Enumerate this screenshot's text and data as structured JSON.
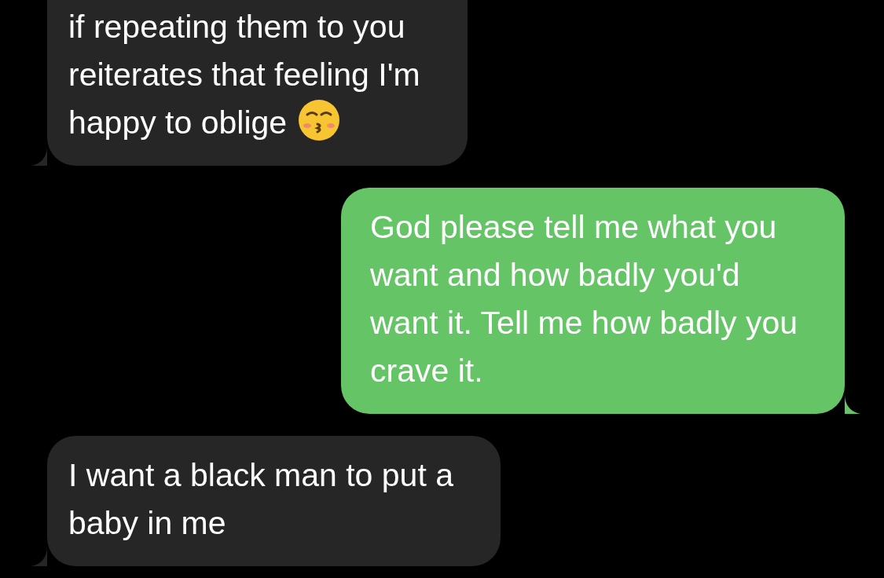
{
  "messages": [
    {
      "kind": "received",
      "lines": [
        "if repeating them to you",
        "reiterates that feeling I'm",
        "happy to oblige"
      ],
      "emoji": true,
      "cut_top": true
    },
    {
      "kind": "sent",
      "lines": [
        "God please tell me what you",
        "want and how badly you'd",
        "want it. Tell me how badly you",
        "crave it."
      ],
      "emoji": false,
      "cut_top": false
    },
    {
      "kind": "received",
      "lines": [
        "I want a black man to put a",
        "baby in me"
      ],
      "emoji": false,
      "cut_top": false
    }
  ]
}
